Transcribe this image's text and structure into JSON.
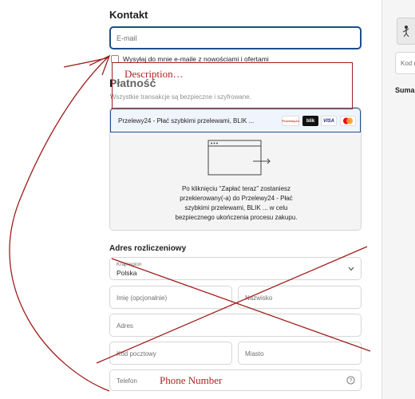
{
  "contact": {
    "heading": "Kontakt",
    "email_placeholder": "E-mail",
    "newsletter_label": "Wysyłaj do mnie e-maile z nowościami i ofertami"
  },
  "payment": {
    "heading": "Płatność",
    "subtitle": "Wszystkie transakcje są bezpieczne i szyfrowane.",
    "method_label": "Przelewy24 - Płać szybkimi przelewami, BLIK ...",
    "logos": [
      "Przelewy24",
      "blik",
      "VISA",
      "mastercard"
    ],
    "redirect_message": "Po kliknięciu “Zapłać teraz” zostaniesz przekierowany(-a) do Przelewy24 - Płać szybkimi przelewami, BLIK ... w celu bezpiecznego ukończenia procesu zakupu."
  },
  "billing": {
    "heading": "Adres rozliczeniowy",
    "country_label": "Kraj/region",
    "country_value": "Polska",
    "first_name_placeholder": "Imię (opcjonalnie)",
    "last_name_placeholder": "Nazwisko",
    "address_placeholder": "Adres",
    "postal_placeholder": "Kod pocztowy",
    "city_placeholder": "Miasto",
    "phone_placeholder": "Telefon"
  },
  "sidebar": {
    "code_placeholder": "Kod r",
    "sum_label": "Suma"
  },
  "annotations": {
    "description_label": "Description…",
    "phone_label": "Phone Number"
  },
  "colors": {
    "accent": "#1c4e8a",
    "annotation": "#b02222"
  }
}
